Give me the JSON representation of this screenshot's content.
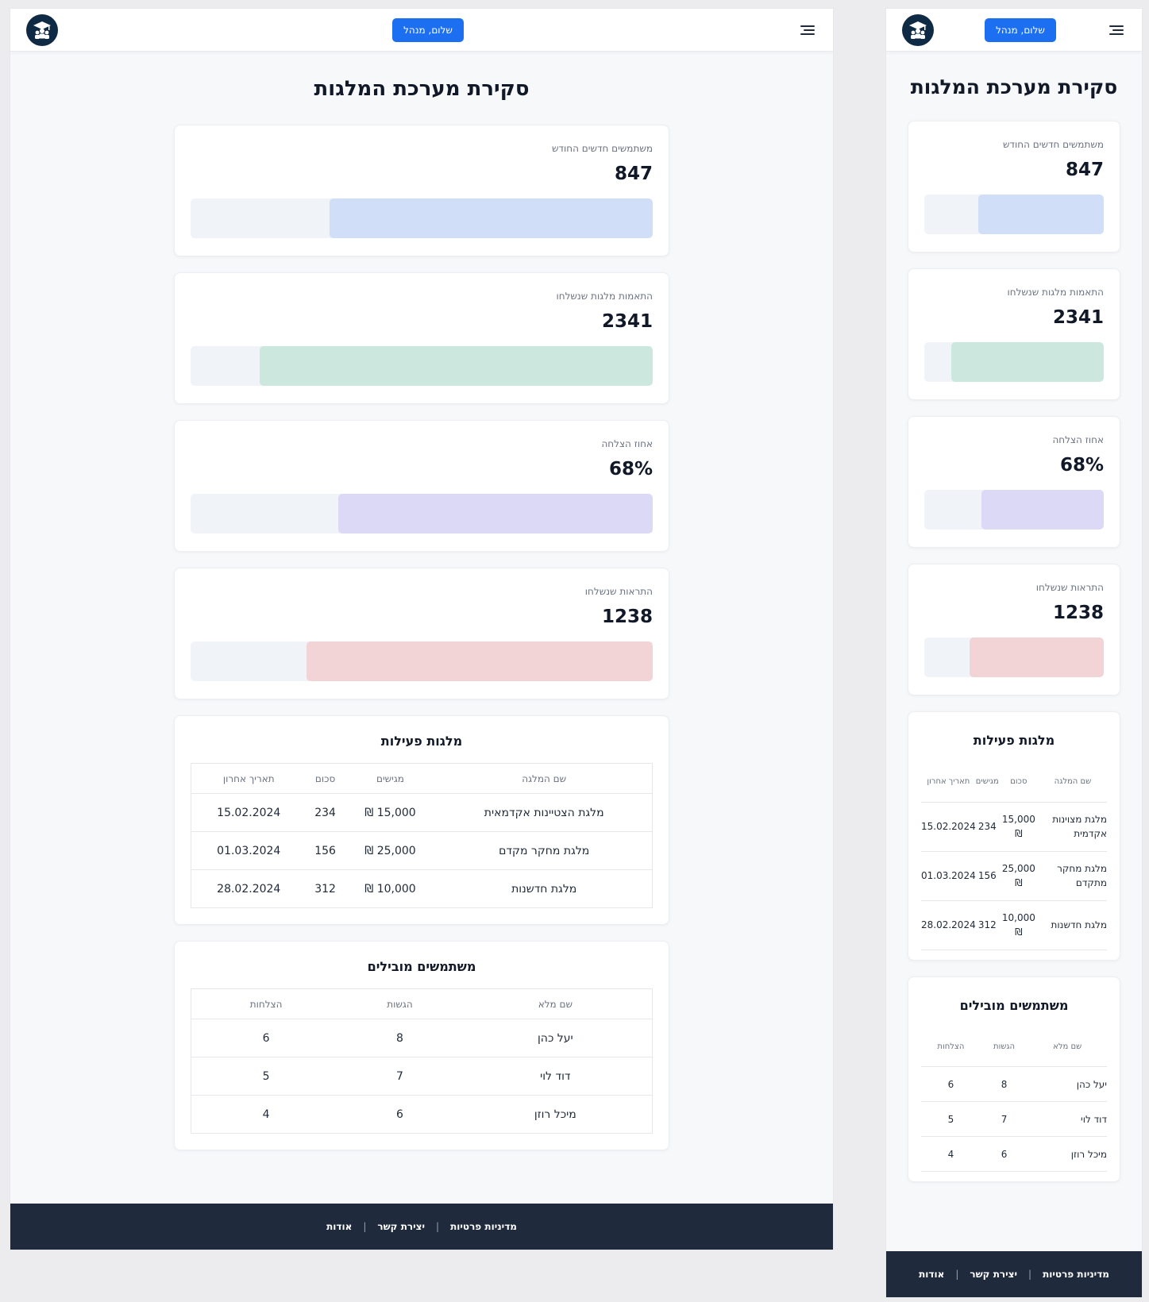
{
  "header": {
    "greeting_button": "שלום, מנהל"
  },
  "page": {
    "title": "סקירת מערכת המלגות"
  },
  "colors": {
    "primary": "#1d6ff2",
    "logo_bg": "#0f2a44",
    "footer_bg": "#1f2a3d",
    "bar_track": "#f0f3f8",
    "bar_blue": "#d0dff7",
    "bar_green": "#cce8de",
    "bar_purple": "#dcd9f7",
    "bar_red": "#f2d3d6"
  },
  "stats": [
    {
      "label": "משתמשים חדשים החודש",
      "value": "847",
      "fill_desktop": 0.7,
      "fill_mobile": 0.7,
      "color": "#d0dff7"
    },
    {
      "label": "התאמות מלגות שנשלחו",
      "value": "2341",
      "fill_desktop": 0.85,
      "fill_mobile": 0.85,
      "color": "#cce8de"
    },
    {
      "label": "אחוז הצלחה",
      "value": "68%",
      "fill_desktop": 0.68,
      "fill_mobile": 0.68,
      "color": "#dcd9f7"
    },
    {
      "label": "התראות שנשלחו",
      "value": "1238",
      "fill_desktop": 0.75,
      "fill_mobile": 0.75,
      "color": "#f2d3d6"
    }
  ],
  "scholarships": {
    "title": "מלגות פעילות",
    "columns": [
      "שם המלגה",
      "סכום",
      "מגישים",
      "תאריך אחרון"
    ],
    "rows": [
      {
        "name_desktop": "מלגת הצטיינות אקדמאית",
        "name_mobile": "מלגת מצוינות אקדמית",
        "amount": "15,000 ₪",
        "applicants": "234",
        "deadline": "15.02.2024"
      },
      {
        "name_desktop": "מלגת מחקר מקדם",
        "name_mobile": "מלגת מחקר מתקדם",
        "amount": "25,000 ₪",
        "applicants": "156",
        "deadline": "01.03.2024"
      },
      {
        "name_desktop": "מלגת חדשנות",
        "name_mobile": "מלגת חדשנות",
        "amount": "10,000 ₪",
        "applicants": "312",
        "deadline": "28.02.2024"
      }
    ]
  },
  "leading_users": {
    "title": "משתמשים מובילים",
    "columns": [
      "שם מלא",
      "הגשות",
      "הצלחות"
    ],
    "rows": [
      {
        "name": "יעל כהן",
        "submissions": "8",
        "successes": "6"
      },
      {
        "name": "דוד לוי",
        "submissions": "7",
        "successes": "5"
      },
      {
        "name": "מיכל רוזן",
        "submissions": "6",
        "successes": "4"
      }
    ]
  },
  "footer": {
    "privacy": "מדיניות פרטיות",
    "contact": "יצירת קשר",
    "about": "אודות",
    "separator": "|"
  }
}
